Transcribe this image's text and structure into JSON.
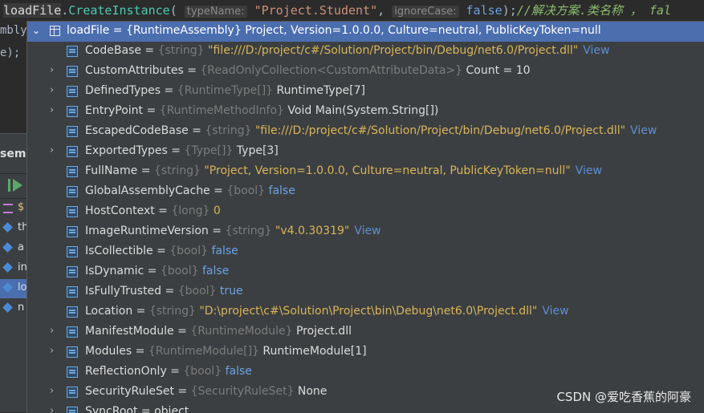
{
  "code": {
    "var": "loadFile",
    "dot": ".",
    "method": "CreateInstance",
    "open": "(",
    "hint1": "typeName:",
    "arg1": "\"Project.Student\"",
    "comma": ",",
    "hint2": "ignoreCase:",
    "arg2": "false",
    "close": ");",
    "comment": "//解决方案.类名称 ， fal"
  },
  "left": {
    "frag1": "mbly",
    "frag2": "e);",
    "panel_title": "sembly",
    "rows": [
      "$",
      "th",
      "a",
      "in",
      "lo",
      "n"
    ]
  },
  "root": {
    "text": "loadFile = {RuntimeAssembly} Project, Version=1.0.0.0, Culture=neutral, PublicKeyToken=null"
  },
  "items": [
    {
      "name": "CodeBase",
      "type": "{string}",
      "value": "\"file:///D:/project/c#/Solution/Project/bin/Debug/net6.0/Project.dll\"",
      "vkind": "s",
      "view": "View",
      "expand": false
    },
    {
      "name": "CustomAttributes",
      "type": "{ReadOnlyCollection<CustomAttributeData>}",
      "value": "Count = 10",
      "vkind": "n",
      "view": "",
      "expand": true
    },
    {
      "name": "DefinedTypes",
      "type": "{RuntimeType[]}",
      "value": "RuntimeType[7]",
      "vkind": "n",
      "view": "",
      "expand": true
    },
    {
      "name": "EntryPoint",
      "type": "{RuntimeMethodInfo}",
      "value": "Void Main(System.String[])",
      "vkind": "n",
      "view": "",
      "expand": true
    },
    {
      "name": "EscapedCodeBase",
      "type": "{string}",
      "value": "\"file:///D:/project/c#/Solution/Project/bin/Debug/net6.0/Project.dll\"",
      "vkind": "s",
      "view": "View",
      "expand": false
    },
    {
      "name": "ExportedTypes",
      "type": "{Type[]}",
      "value": "Type[3]",
      "vkind": "n",
      "view": "",
      "expand": true
    },
    {
      "name": "FullName",
      "type": "{string}",
      "value": "\"Project, Version=1.0.0.0, Culture=neutral, PublicKeyToken=null\"",
      "vkind": "s",
      "view": "View",
      "expand": false
    },
    {
      "name": "GlobalAssemblyCache",
      "type": "{bool}",
      "value": "false",
      "vkind": "b",
      "view": "",
      "expand": false
    },
    {
      "name": "HostContext",
      "type": "{long}",
      "value": "0",
      "vkind": "s",
      "view": "",
      "expand": false
    },
    {
      "name": "ImageRuntimeVersion",
      "type": "{string}",
      "value": "\"v4.0.30319\"",
      "vkind": "s",
      "view": "View",
      "expand": false
    },
    {
      "name": "IsCollectible",
      "type": "{bool}",
      "value": "false",
      "vkind": "b",
      "view": "",
      "expand": false
    },
    {
      "name": "IsDynamic",
      "type": "{bool}",
      "value": "false",
      "vkind": "b",
      "view": "",
      "expand": false
    },
    {
      "name": "IsFullyTrusted",
      "type": "{bool}",
      "value": "true",
      "vkind": "b",
      "view": "",
      "expand": false
    },
    {
      "name": "Location",
      "type": "{string}",
      "value": "\"D:\\project\\c#\\Solution\\Project\\bin\\Debug\\net6.0\\Project.dll\"",
      "vkind": "s",
      "view": "View",
      "expand": false
    },
    {
      "name": "ManifestModule",
      "type": "{RuntimeModule}",
      "value": "Project.dll",
      "vkind": "n",
      "view": "",
      "expand": true
    },
    {
      "name": "Modules",
      "type": "{RuntimeModule[]}",
      "value": "RuntimeModule[1]",
      "vkind": "n",
      "view": "",
      "expand": true
    },
    {
      "name": "ReflectionOnly",
      "type": "{bool}",
      "value": "false",
      "vkind": "b",
      "view": "",
      "expand": false
    },
    {
      "name": "SecurityRuleSet",
      "type": "{SecurityRuleSet}",
      "value": "None",
      "vkind": "n",
      "view": "",
      "expand": true
    },
    {
      "name": "SyncRoot",
      "type": "",
      "value": "object",
      "vkind": "n",
      "view": "",
      "expand": true
    }
  ],
  "watermark": "CSDN @爱吃香蕉的阿豪"
}
